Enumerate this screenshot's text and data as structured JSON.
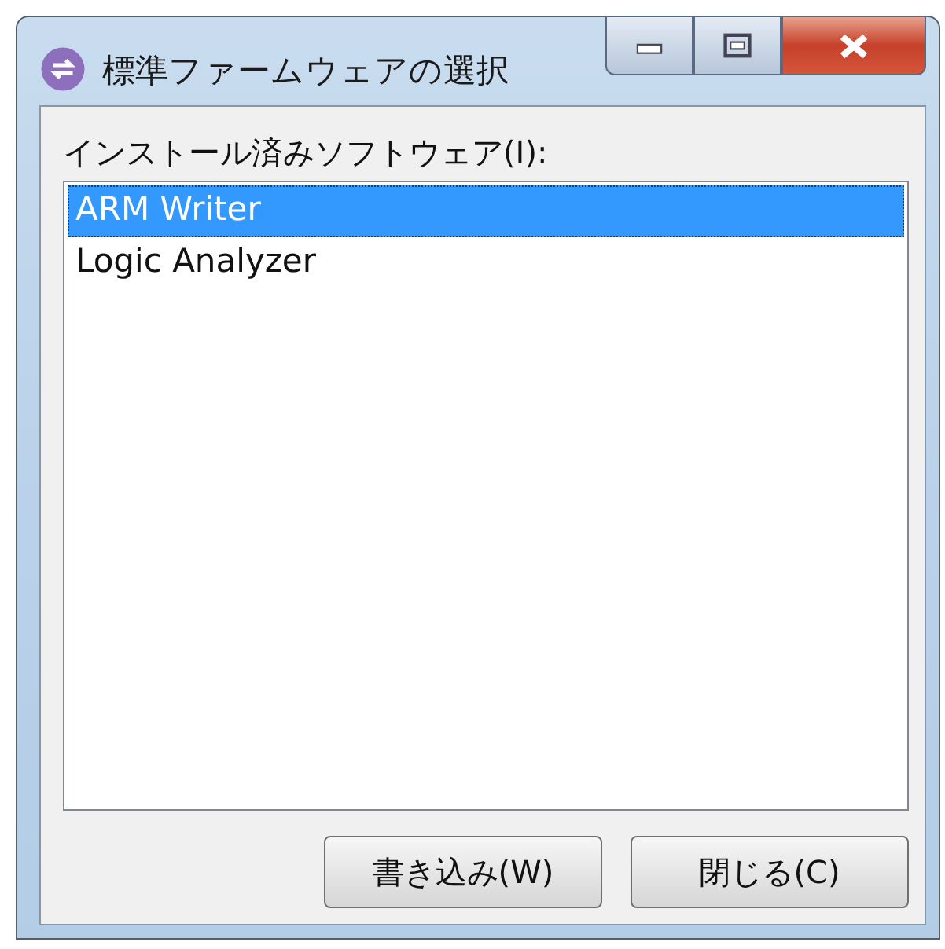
{
  "window": {
    "title": "標準ファームウェアの選択"
  },
  "list": {
    "label": "インストール済みソフトウェア(I):",
    "items": [
      {
        "label": "ARM Writer",
        "selected": true
      },
      {
        "label": "Logic Analyzer",
        "selected": false
      }
    ]
  },
  "buttons": [
    "書き込み(W)",
    "閉じる(C)"
  ]
}
